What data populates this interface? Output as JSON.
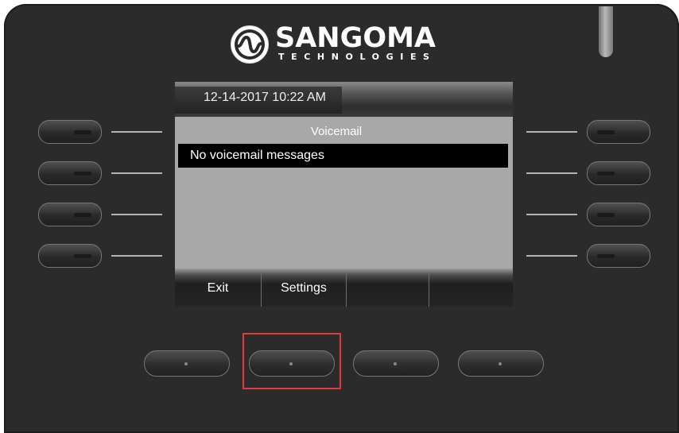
{
  "brand": {
    "name": "SANGOMA",
    "tagline": "TECHNOLOGIES",
    "logo_icon": "sangoma-logo-icon"
  },
  "screen": {
    "datetime": "12-14-2017 10:22 AM",
    "title": "Voicemail",
    "message": "No voicemail messages",
    "softkeys": [
      "Exit",
      "Settings",
      "",
      ""
    ]
  },
  "colors": {
    "highlight": "#e03a3a",
    "selected_row": "#000000",
    "screen_bg": "#a8a8a8"
  }
}
